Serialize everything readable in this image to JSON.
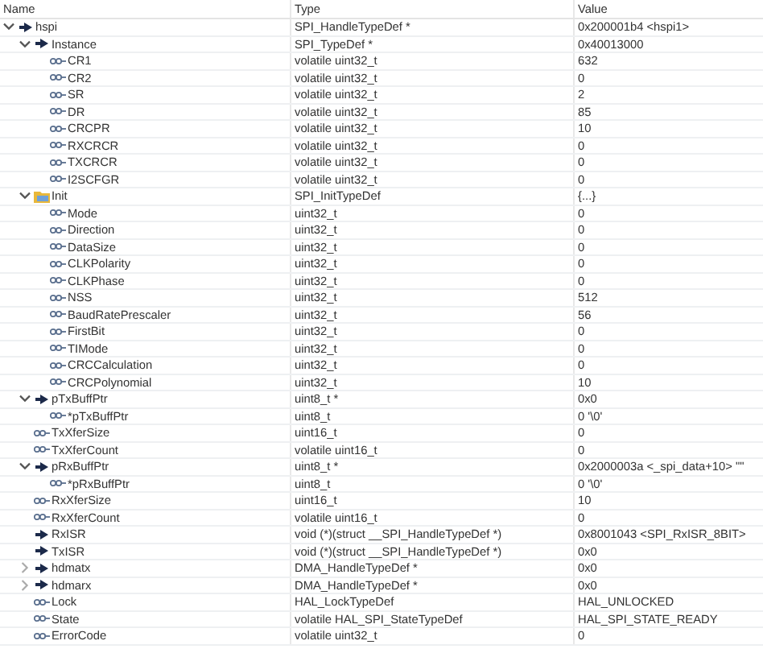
{
  "columns": [
    "Name",
    "Type",
    "Value"
  ],
  "variables": [
    {
      "name": "hspi",
      "kind": "pointer",
      "type": "SPI_HandleTypeDef *",
      "value": "0x200001b4 <hspi1>",
      "expanded": true,
      "children": [
        {
          "name": "Instance",
          "kind": "pointer",
          "type": "SPI_TypeDef *",
          "value": "0x40013000",
          "expanded": true,
          "children": [
            {
              "name": "CR1",
              "kind": "variable",
              "type": "volatile uint32_t",
              "value": "632"
            },
            {
              "name": "CR2",
              "kind": "variable",
              "type": "volatile uint32_t",
              "value": "0"
            },
            {
              "name": "SR",
              "kind": "variable",
              "type": "volatile uint32_t",
              "value": "2"
            },
            {
              "name": "DR",
              "kind": "variable",
              "type": "volatile uint32_t",
              "value": "85"
            },
            {
              "name": "CRCPR",
              "kind": "variable",
              "type": "volatile uint32_t",
              "value": "10"
            },
            {
              "name": "RXCRCR",
              "kind": "variable",
              "type": "volatile uint32_t",
              "value": "0"
            },
            {
              "name": "TXCRCR",
              "kind": "variable",
              "type": "volatile uint32_t",
              "value": "0"
            },
            {
              "name": "I2SCFGR",
              "kind": "variable",
              "type": "volatile uint32_t",
              "value": "0"
            }
          ]
        },
        {
          "name": "Init",
          "kind": "struct",
          "type": "SPI_InitTypeDef",
          "value": "{...}",
          "expanded": true,
          "children": [
            {
              "name": "Mode",
              "kind": "variable",
              "type": "uint32_t",
              "value": "0"
            },
            {
              "name": "Direction",
              "kind": "variable",
              "type": "uint32_t",
              "value": "0"
            },
            {
              "name": "DataSize",
              "kind": "variable",
              "type": "uint32_t",
              "value": "0"
            },
            {
              "name": "CLKPolarity",
              "kind": "variable",
              "type": "uint32_t",
              "value": "0"
            },
            {
              "name": "CLKPhase",
              "kind": "variable",
              "type": "uint32_t",
              "value": "0"
            },
            {
              "name": "NSS",
              "kind": "variable",
              "type": "uint32_t",
              "value": "512"
            },
            {
              "name": "BaudRatePrescaler",
              "kind": "variable",
              "type": "uint32_t",
              "value": "56"
            },
            {
              "name": "FirstBit",
              "kind": "variable",
              "type": "uint32_t",
              "value": "0"
            },
            {
              "name": "TIMode",
              "kind": "variable",
              "type": "uint32_t",
              "value": "0"
            },
            {
              "name": "CRCCalculation",
              "kind": "variable",
              "type": "uint32_t",
              "value": "0"
            },
            {
              "name": "CRCPolynomial",
              "kind": "variable",
              "type": "uint32_t",
              "value": "10"
            }
          ]
        },
        {
          "name": "pTxBuffPtr",
          "kind": "pointer",
          "type": "uint8_t *",
          "value": "0x0",
          "expanded": true,
          "children": [
            {
              "name": "*pTxBuffPtr",
              "kind": "variable",
              "type": "uint8_t",
              "value": "0 '\\0'"
            }
          ]
        },
        {
          "name": "TxXferSize",
          "kind": "variable",
          "type": "uint16_t",
          "value": "0"
        },
        {
          "name": "TxXferCount",
          "kind": "variable",
          "type": "volatile uint16_t",
          "value": "0"
        },
        {
          "name": "pRxBuffPtr",
          "kind": "pointer",
          "type": "uint8_t *",
          "value": "0x2000003a <_spi_data+10> \"\"",
          "expanded": true,
          "children": [
            {
              "name": "*pRxBuffPtr",
              "kind": "variable",
              "type": "uint8_t",
              "value": "0 '\\0'"
            }
          ]
        },
        {
          "name": "RxXferSize",
          "kind": "variable",
          "type": "uint16_t",
          "value": "10"
        },
        {
          "name": "RxXferCount",
          "kind": "variable",
          "type": "volatile uint16_t",
          "value": "0"
        },
        {
          "name": "RxISR",
          "kind": "pointer",
          "type": "void (*)(struct __SPI_HandleTypeDef *)",
          "value": "0x8001043 <SPI_RxISR_8BIT>"
        },
        {
          "name": "TxISR",
          "kind": "pointer",
          "type": "void (*)(struct __SPI_HandleTypeDef *)",
          "value": "0x0"
        },
        {
          "name": "hdmatx",
          "kind": "pointer",
          "type": "DMA_HandleTypeDef *",
          "value": "0x0",
          "expanded": false
        },
        {
          "name": "hdmarx",
          "kind": "pointer",
          "type": "DMA_HandleTypeDef *",
          "value": "0x0",
          "expanded": false
        },
        {
          "name": "Lock",
          "kind": "variable",
          "type": "HAL_LockTypeDef",
          "value": "HAL_UNLOCKED"
        },
        {
          "name": "State",
          "kind": "variable",
          "type": "volatile HAL_SPI_StateTypeDef",
          "value": "HAL_SPI_STATE_READY"
        },
        {
          "name": "ErrorCode",
          "kind": "variable",
          "type": "volatile uint32_t",
          "value": "0"
        }
      ]
    }
  ]
}
